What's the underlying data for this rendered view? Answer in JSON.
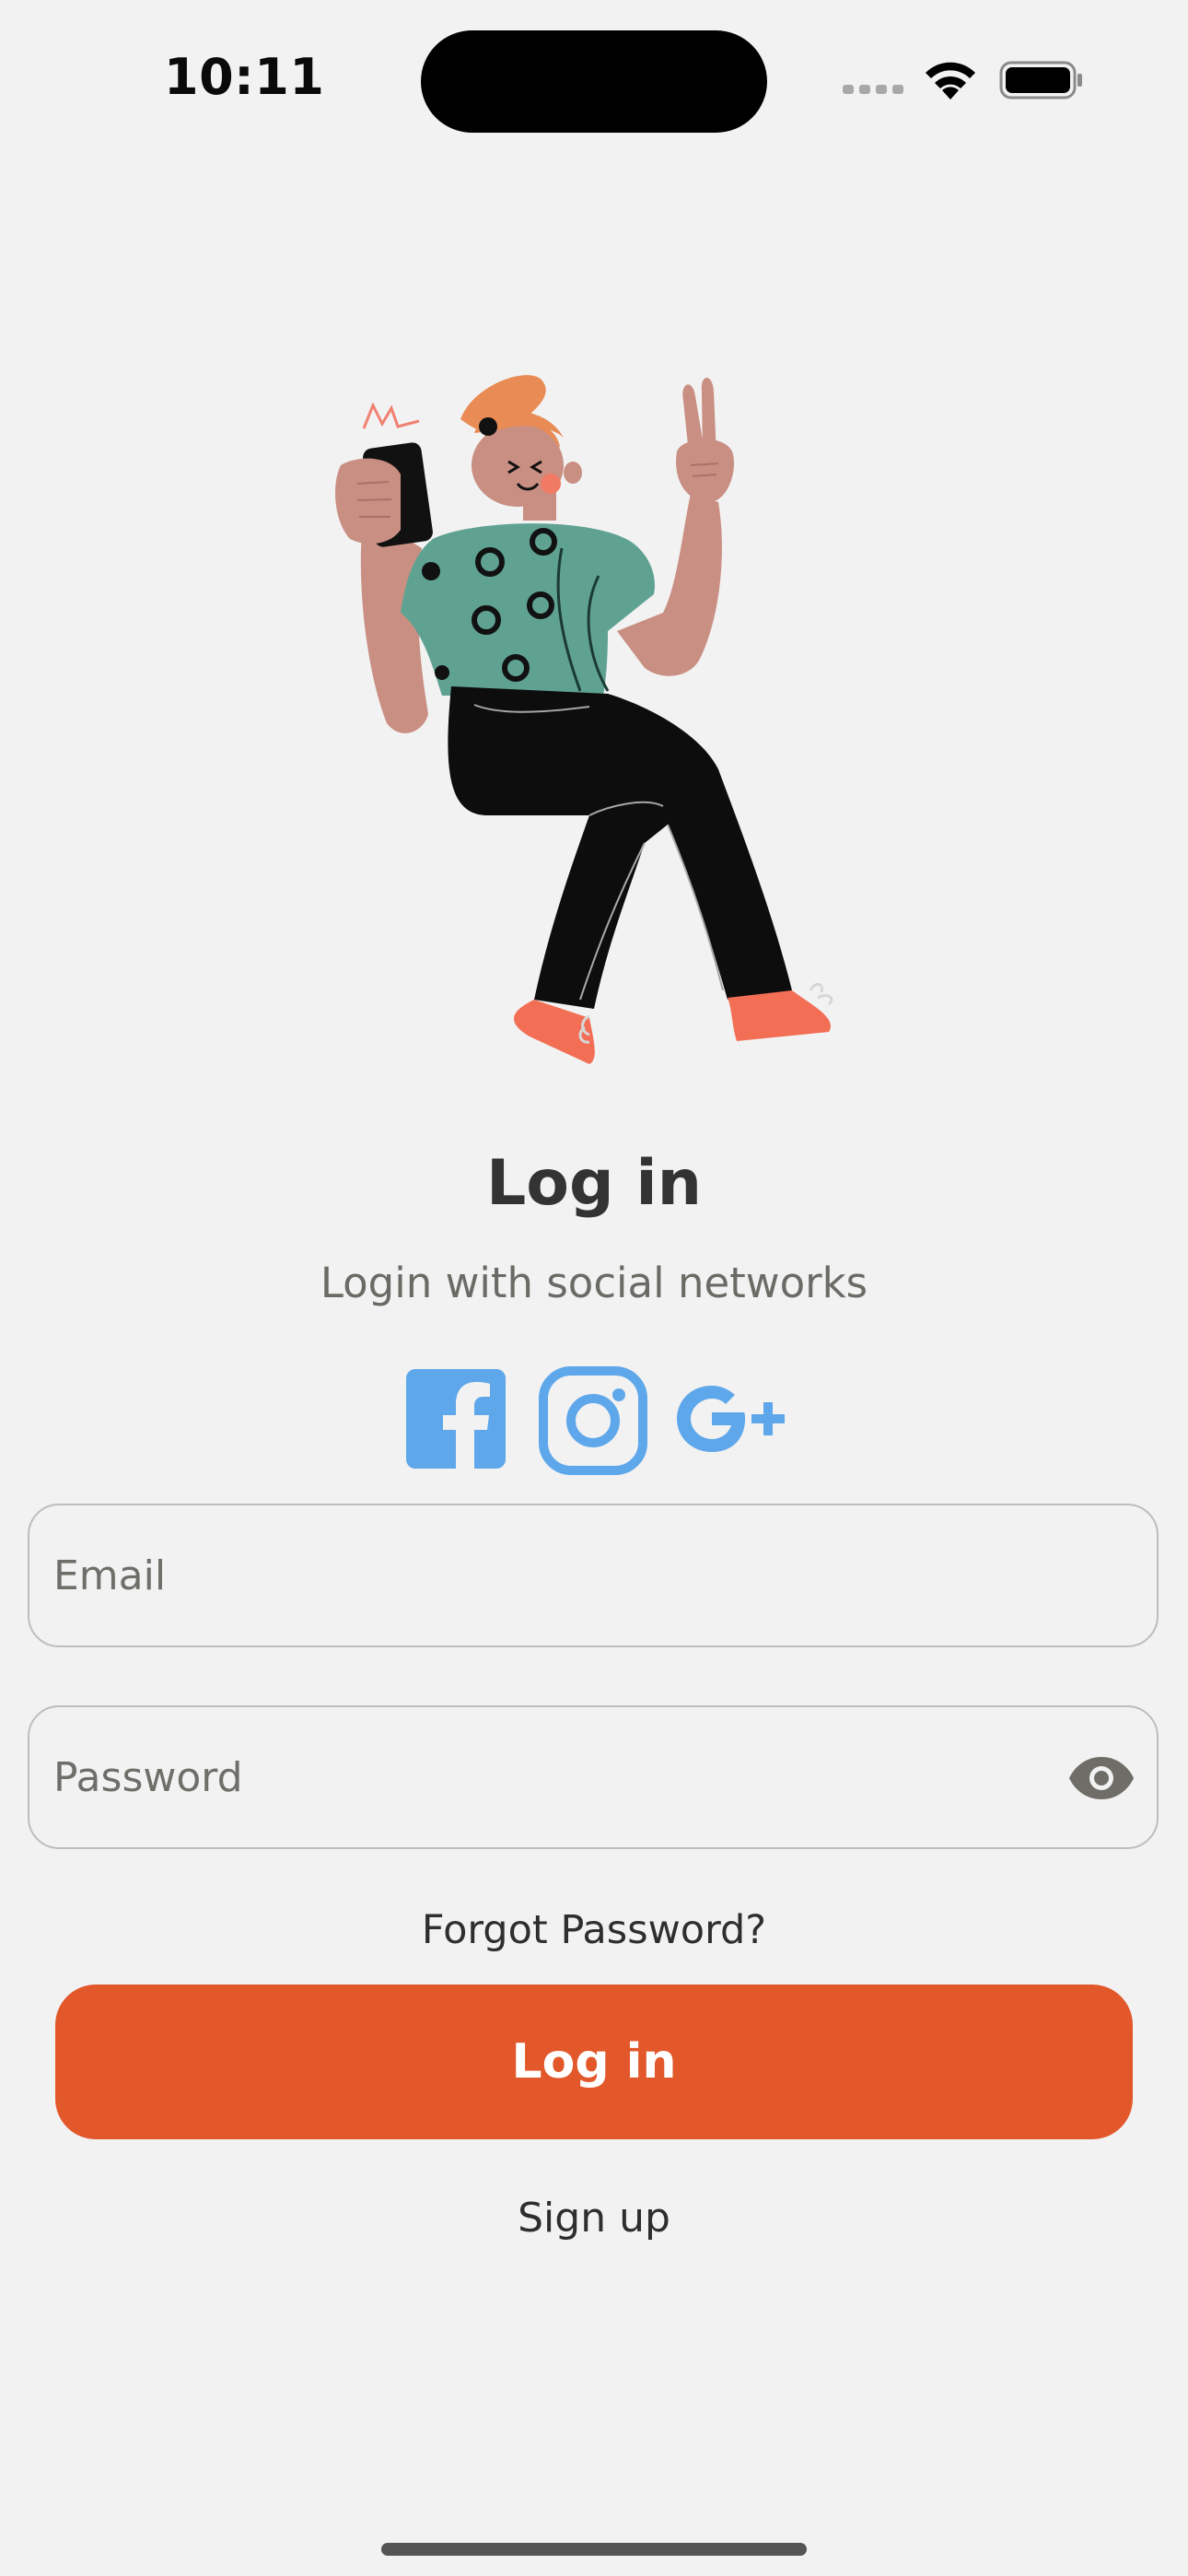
{
  "status_bar": {
    "time": "10:11"
  },
  "login": {
    "title": "Log in",
    "subtitle": "Login with social networks",
    "social": [
      {
        "name": "facebook",
        "icon": "facebook-icon"
      },
      {
        "name": "instagram",
        "icon": "instagram-icon"
      },
      {
        "name": "google-plus",
        "icon": "google-plus-icon"
      }
    ],
    "email": {
      "placeholder": "Email",
      "value": ""
    },
    "password": {
      "placeholder": "Password",
      "value": "",
      "toggle_icon": "eye-icon"
    },
    "forgot_label": "Forgot Password?",
    "submit_label": "Log in",
    "signup_label": "Sign up"
  },
  "colors": {
    "background": "#f2f2f2",
    "accent": "#e2582b",
    "social_blue": "#5ea7ea",
    "title": "#333333",
    "subtitle": "#6b6b66"
  }
}
